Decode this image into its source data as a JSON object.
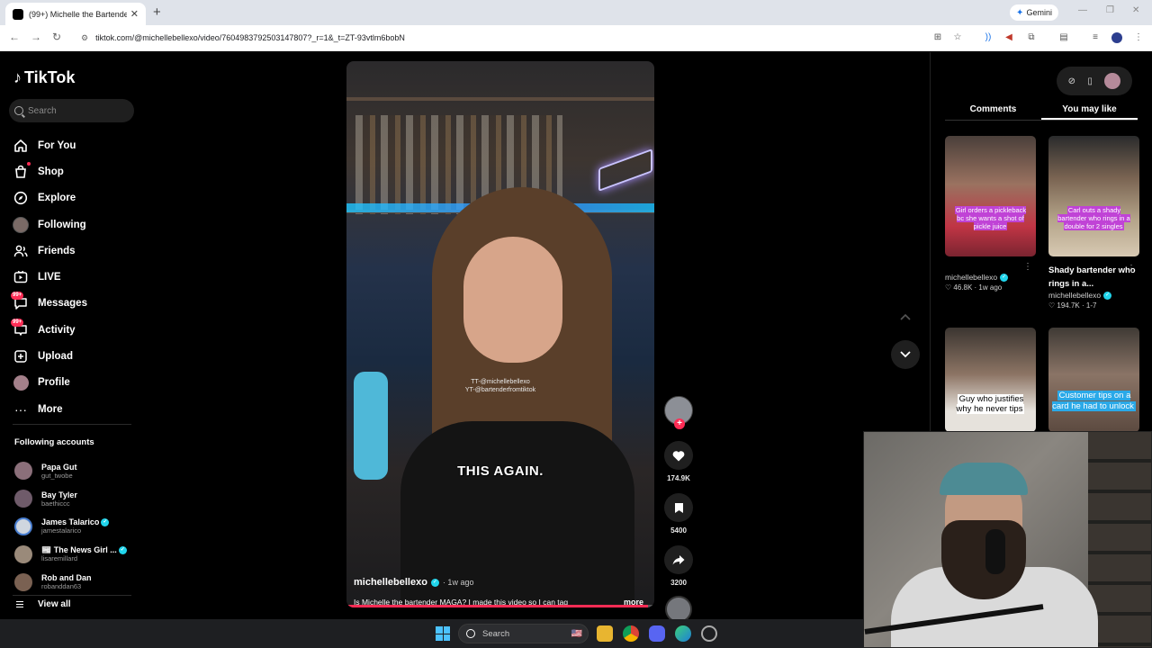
{
  "browser": {
    "tab_title": "(99+) Michelle the Bartender",
    "tab_close": "✕",
    "new_tab": "+",
    "gemini_label": "Gemini",
    "url": "tiktok.com/@michellebellexo/video/7604983792503147807?_r=1&_t=ZT-93vtlm6bobN"
  },
  "sidebar": {
    "logo_text": "TikTok",
    "search_placeholder": "Search",
    "nav": [
      {
        "label": "For You",
        "icon": "home-icon"
      },
      {
        "label": "Shop",
        "icon": "shop-icon"
      },
      {
        "label": "Explore",
        "icon": "compass-icon"
      },
      {
        "label": "Following",
        "icon": "following-avatar"
      },
      {
        "label": "Friends",
        "icon": "friends-icon"
      },
      {
        "label": "LIVE",
        "icon": "live-icon"
      },
      {
        "label": "Messages",
        "icon": "messages-icon",
        "badge": "99+"
      },
      {
        "label": "Activity",
        "icon": "activity-icon",
        "badge": "99+"
      },
      {
        "label": "Upload",
        "icon": "upload-icon"
      },
      {
        "label": "Profile",
        "icon": "profile-avatar"
      },
      {
        "label": "More",
        "icon": "more-icon"
      }
    ],
    "following_title": "Following accounts",
    "following": [
      {
        "name": "Papa Gut",
        "handle": "gut_twobe",
        "verified": false,
        "color": "#8b6f7a"
      },
      {
        "name": "Bay Tyler",
        "handle": "baethiccc",
        "verified": false,
        "color": "#6f5b6a"
      },
      {
        "name": "James Talarico",
        "handle": "jamestalarico",
        "verified": true,
        "color": "#cfd6df"
      },
      {
        "name": "📰 The News Girl ...",
        "handle": "lisaremillard",
        "verified": true,
        "color": "#9a8a7a"
      },
      {
        "name": "Rob and Dan",
        "handle": "robanddan63",
        "verified": false,
        "color": "#7a6152"
      }
    ],
    "view_all": "View all"
  },
  "video": {
    "watermark_line1": "TT-@michellebellexo",
    "watermark_line2": "YT-@bartenderfromtiktok",
    "caption": "THIS AGAIN.",
    "author": "michellebellexo",
    "posted": "· 1w ago",
    "description": "Is Michelle the bartender MAGA? I made this video so I can tag",
    "more": "more",
    "progress": 0.98
  },
  "actions": {
    "likes": "174.9K",
    "saves": "5400",
    "shares": "3200"
  },
  "right_panel": {
    "tabs": [
      "Comments",
      "You may like"
    ],
    "active_tab": "You may like",
    "cards": [
      {
        "caption": "Girl orders a pickleback bc she wants a shot of pickle juice",
        "title": "",
        "author": "michellebellexo",
        "likes": "♡ 46.8K",
        "meta": "· 1w ago"
      },
      {
        "caption": "Carl outs a shady bartender who rings in a double for 2 singles",
        "title": "Shady bartender who rings in a...",
        "author": "michellebellexo",
        "likes": "♡ 194.7K",
        "meta": "· 1-7"
      },
      {
        "caption": "Guy who justifies why he never tips"
      },
      {
        "caption": "Customer tips on a card he had to unlock"
      }
    ]
  },
  "taskbar": {
    "search_placeholder": "Search"
  },
  "colors": {
    "accent": "#fe2c55",
    "verified": "#20d5ec"
  }
}
